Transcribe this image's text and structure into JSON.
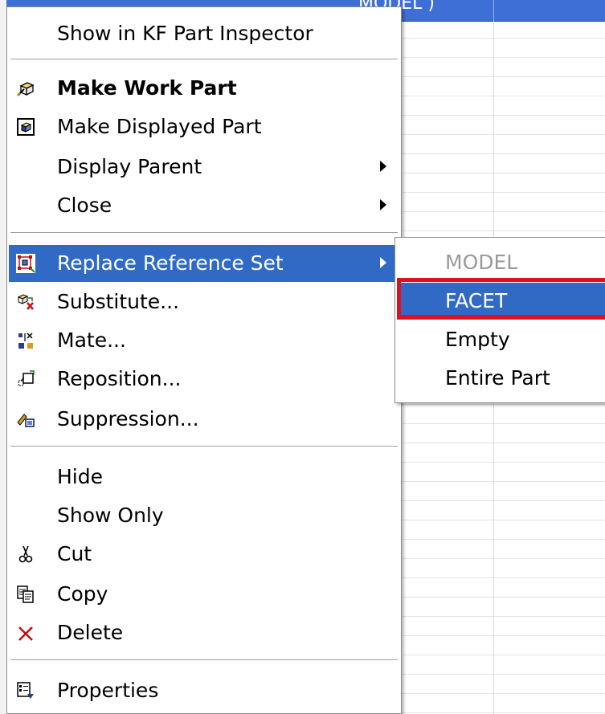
{
  "background_table": {
    "header_text": "MODEL )"
  },
  "menu": {
    "items": [
      {
        "label": "Show in KF Part Inspector"
      },
      {
        "label": "Make Work Part",
        "icon": "make-work-part-icon"
      },
      {
        "label": "Make Displayed Part",
        "icon": "make-displayed-part-icon"
      },
      {
        "label": "Display Parent",
        "submenu": true
      },
      {
        "label": "Close",
        "submenu": true
      },
      {
        "label": "Replace Reference Set",
        "icon": "replace-reference-set-icon",
        "submenu": true,
        "highlighted": true
      },
      {
        "label": "Substitute...",
        "icon": "substitute-icon"
      },
      {
        "label": "Mate...",
        "icon": "mate-icon"
      },
      {
        "label": "Reposition...",
        "icon": "reposition-icon"
      },
      {
        "label": "Suppression...",
        "icon": "suppression-icon"
      },
      {
        "label": "Hide"
      },
      {
        "label": "Show Only"
      },
      {
        "label": "Cut",
        "icon": "scissors-icon"
      },
      {
        "label": "Copy",
        "icon": "copy-icon"
      },
      {
        "label": "Delete",
        "icon": "delete-x-icon"
      },
      {
        "label": "Properties",
        "icon": "properties-icon"
      }
    ]
  },
  "submenu": {
    "items": [
      {
        "label": "MODEL",
        "disabled": true
      },
      {
        "label": "FACET",
        "highlighted": true
      },
      {
        "label": "Empty"
      },
      {
        "label": "Entire Part"
      }
    ]
  },
  "colors": {
    "highlight": "#316ac5",
    "focus_outline": "#e0101e",
    "disabled_text": "#9a9a9a"
  }
}
